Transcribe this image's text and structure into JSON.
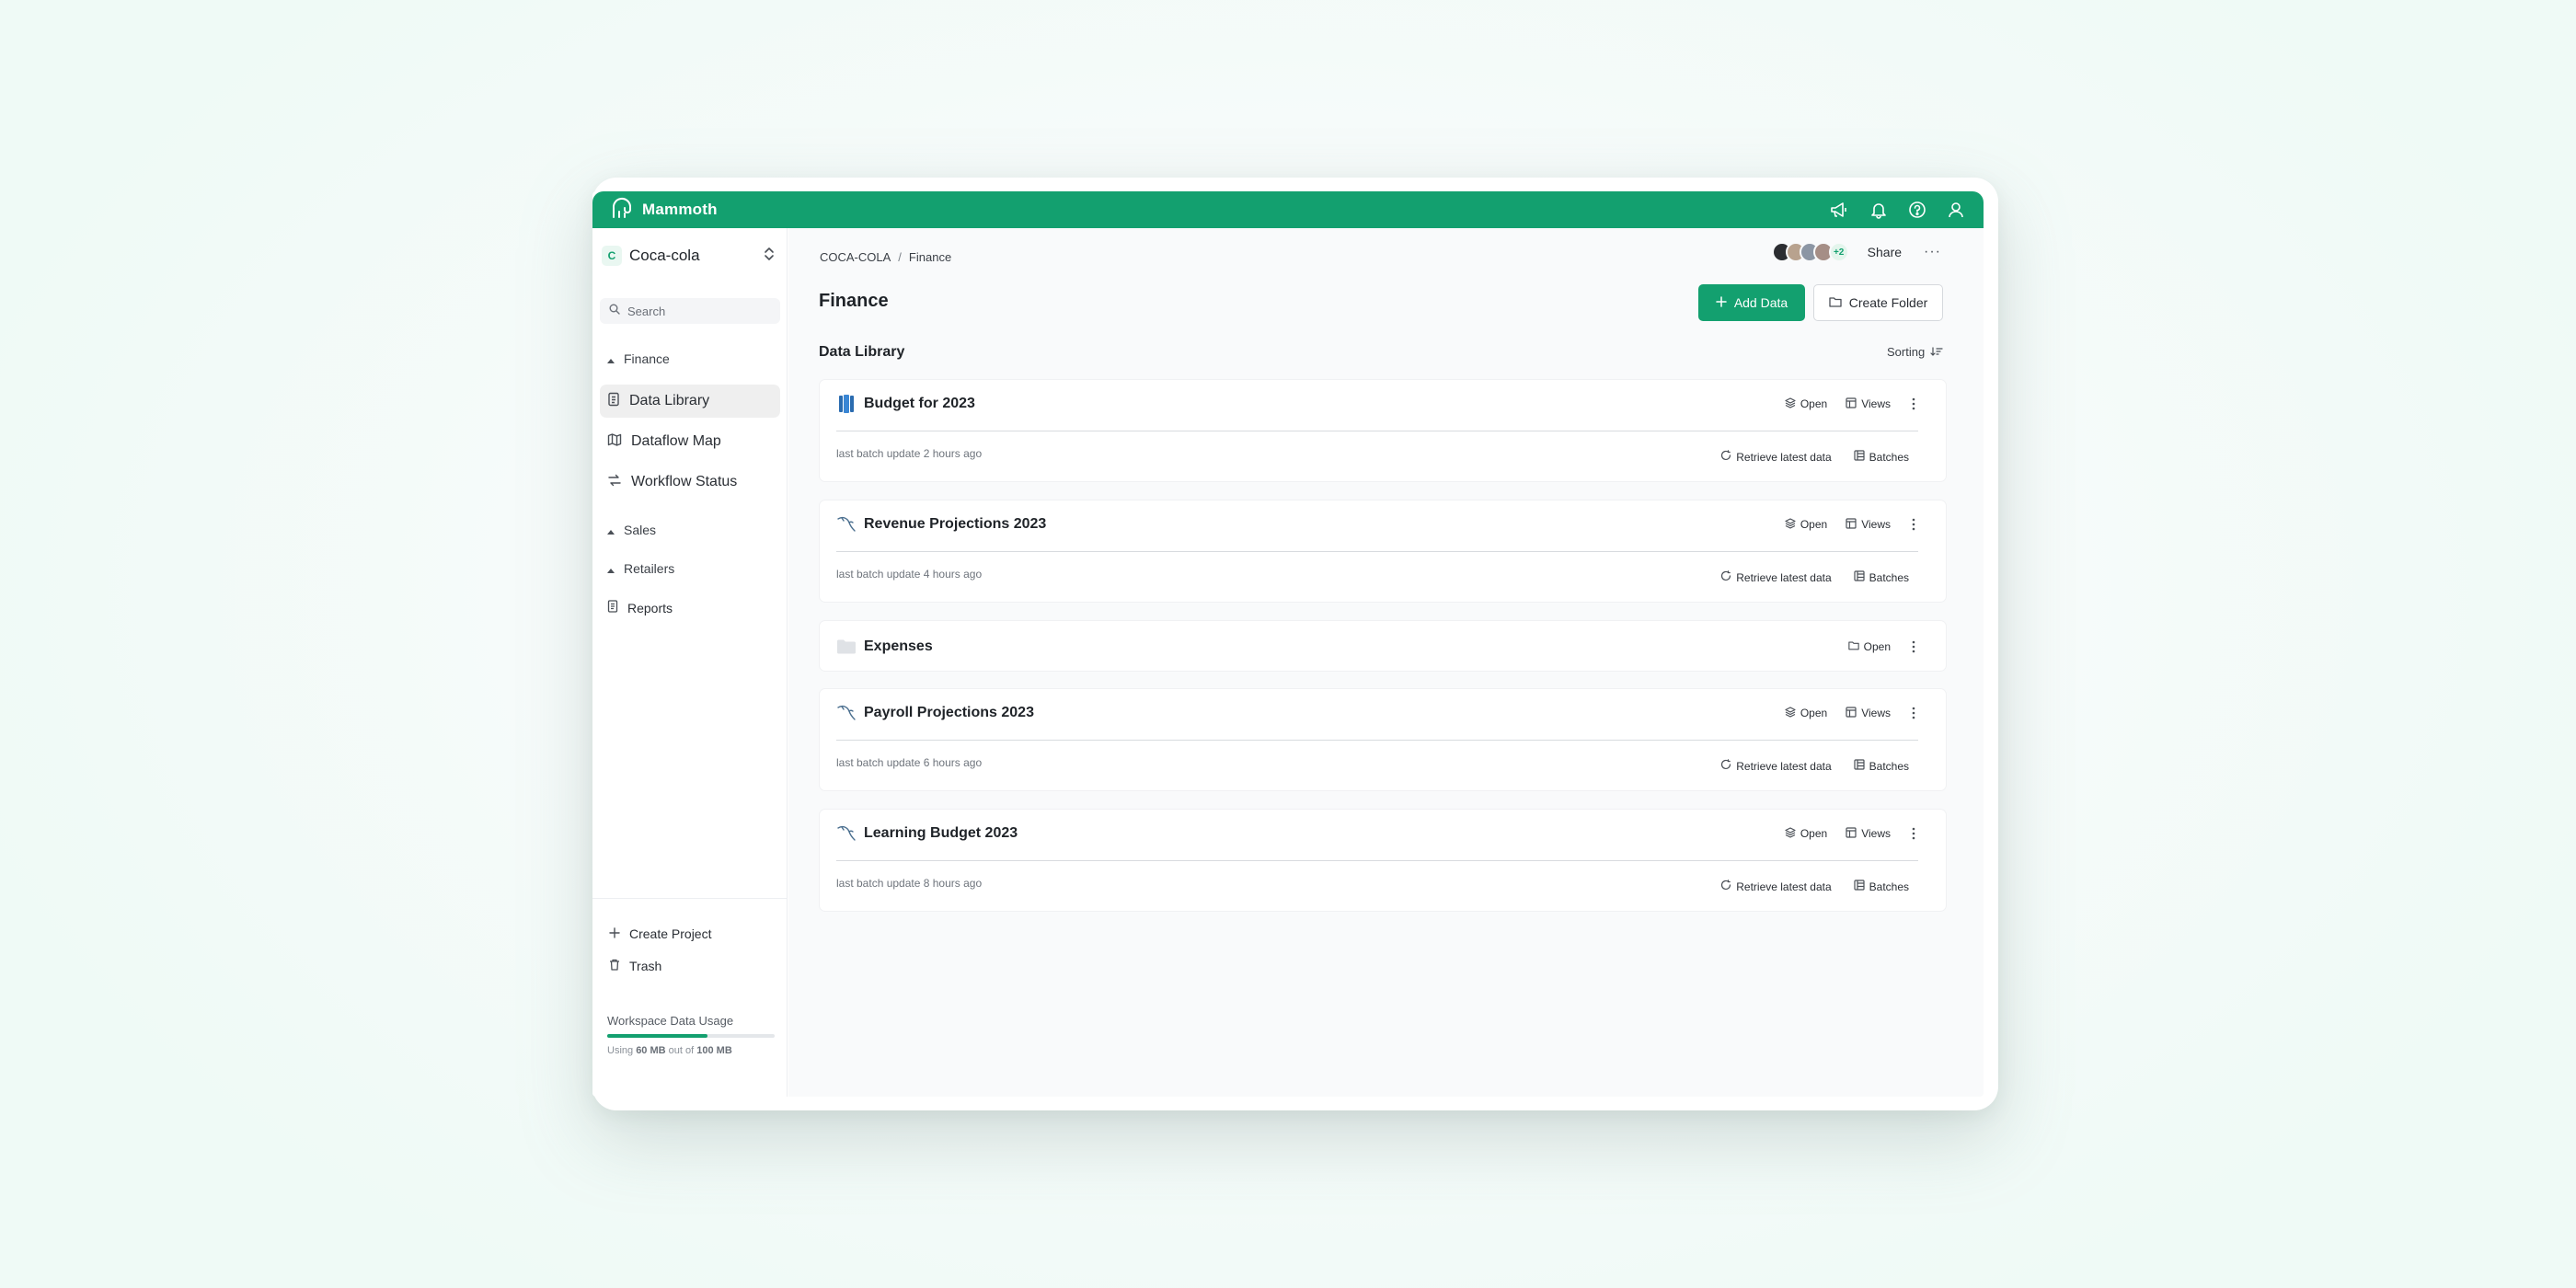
{
  "app": {
    "name": "Mammoth"
  },
  "topbar": {
    "icons": [
      "megaphone-icon",
      "bell-icon",
      "help-icon",
      "user-icon"
    ]
  },
  "sidebar": {
    "workspace": {
      "initial": "C",
      "name": "Coca-cola"
    },
    "search_placeholder": "Search",
    "groups": [
      {
        "label": "Finance",
        "expanded": true
      },
      {
        "label": "Sales",
        "expanded": false
      },
      {
        "label": "Retailers",
        "expanded": false
      }
    ],
    "items": [
      {
        "label": "Data Library",
        "icon": "document-icon",
        "active": true
      },
      {
        "label": "Dataflow Map",
        "icon": "map-icon",
        "active": false
      },
      {
        "label": "Workflow Status",
        "icon": "workflow-icon",
        "active": false
      }
    ],
    "reports": {
      "label": "Reports",
      "icon": "report-icon"
    },
    "create_project": "Create Project",
    "trash": "Trash",
    "usage": {
      "title": "Workspace Data Usage",
      "prefix": "Using",
      "used": "60 MB",
      "middle": "out of",
      "total": "100 MB",
      "fraction": 0.6
    }
  },
  "main": {
    "breadcrumb": {
      "root": "COCA-COLA",
      "sep": "/",
      "current": "Finance"
    },
    "collaborators_more": "+2",
    "share_label": "Share",
    "more_label": "···",
    "title": "Finance",
    "add_data": "Add Data",
    "create_folder": "Create Folder",
    "section_title": "Data Library",
    "sorting": "Sorting",
    "actions": {
      "open": "Open",
      "views": "Views",
      "retrieve": "Retrieve latest data",
      "batches": "Batches"
    },
    "cards": [
      {
        "title": "Budget for 2023",
        "meta": "last batch update 2 hours ago",
        "icon": "database-icon"
      },
      {
        "title": "Revenue Projections 2023",
        "meta": "last batch update 4 hours ago",
        "icon": "mysql-icon"
      },
      {
        "title": "Expenses",
        "icon": "folder-icon"
      },
      {
        "title": "Payroll Projections 2023",
        "meta": "last batch update 6 hours ago",
        "icon": "mysql-icon"
      },
      {
        "title": "Learning Budget 2023",
        "meta": "last batch update 8 hours ago",
        "icon": "mysql-icon"
      }
    ]
  },
  "colors": {
    "brand": "#13a06f",
    "db_blue": "#2b6cb0"
  }
}
